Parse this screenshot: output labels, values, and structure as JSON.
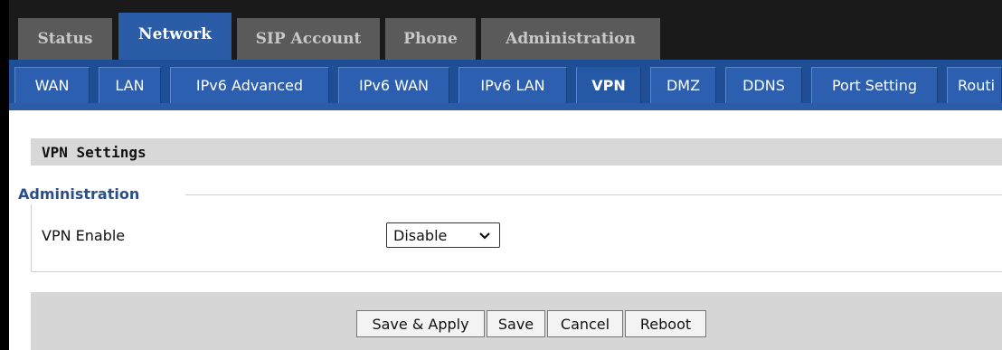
{
  "main_tabs": [
    {
      "label": "Status"
    },
    {
      "label": "Network"
    },
    {
      "label": "SIP Account"
    },
    {
      "label": "Phone"
    },
    {
      "label": "Administration"
    }
  ],
  "active_main_tab": "Network",
  "sub_tabs": [
    {
      "label": "WAN"
    },
    {
      "label": "LAN"
    },
    {
      "label": "IPv6 Advanced"
    },
    {
      "label": "IPv6 WAN"
    },
    {
      "label": "IPv6 LAN"
    },
    {
      "label": "VPN"
    },
    {
      "label": "DMZ"
    },
    {
      "label": "DDNS"
    },
    {
      "label": "Port Setting"
    },
    {
      "label": "Routi"
    }
  ],
  "active_sub_tab": "VPN",
  "section": {
    "title": "VPN Settings",
    "group_legend": "Administration",
    "fields": [
      {
        "label": "VPN Enable",
        "value": "Disable"
      }
    ]
  },
  "buttons": {
    "save_apply": "Save & Apply",
    "save": "Save",
    "cancel": "Cancel",
    "reboot": "Reboot"
  },
  "colors": {
    "active_tab": "#2a5ca8",
    "inactive_main_tab": "#5a5a5a",
    "legend_text": "#2a4f8a"
  }
}
